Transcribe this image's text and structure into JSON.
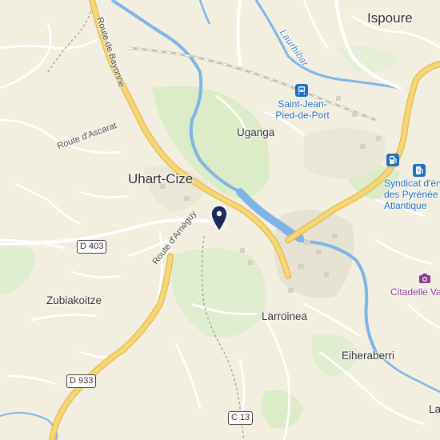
{
  "map": {
    "places": {
      "ispoure": "Ispoure",
      "uhart_cize": "Uhart-Cize",
      "uganga": "Uganga",
      "zubiakoitze": "Zubiakoitze",
      "larroinea": "Larroinea",
      "eiheraberri": "Eiheraberri",
      "la_partial": "La"
    },
    "roads": {
      "route_de_bayonne": "Route de Bayonne",
      "route_d_ascarat": "Route d'Ascarat",
      "route_d_arneguy": "Route d'Arnéguy"
    },
    "shields": {
      "d403": "D 403",
      "d933": "D 933",
      "c13": "C 13"
    },
    "waterways": {
      "laurhibar": "Laurhibar"
    },
    "poi": {
      "station_line1": "Saint-Jean-",
      "station_line2": "Pied-de-Port",
      "syndicat_line1": "Syndicat d'éne",
      "syndicat_line2": "des Pyrénée",
      "syndicat_line3": "Atlantique",
      "citadelle": "Citadelle Vau"
    },
    "icons": [
      "train-station-icon",
      "fuel-station-icon",
      "ev-charging-icon",
      "camera-icon",
      "location-pin-icon"
    ],
    "colors": {
      "land": "#f3efe0",
      "green": "#dcebc8",
      "river": "#7fb5e6",
      "major_road": "#f6d676",
      "pin": "#1f2a5a",
      "transit": "#1f6fc4",
      "attraction": "#8a3a8a"
    }
  }
}
